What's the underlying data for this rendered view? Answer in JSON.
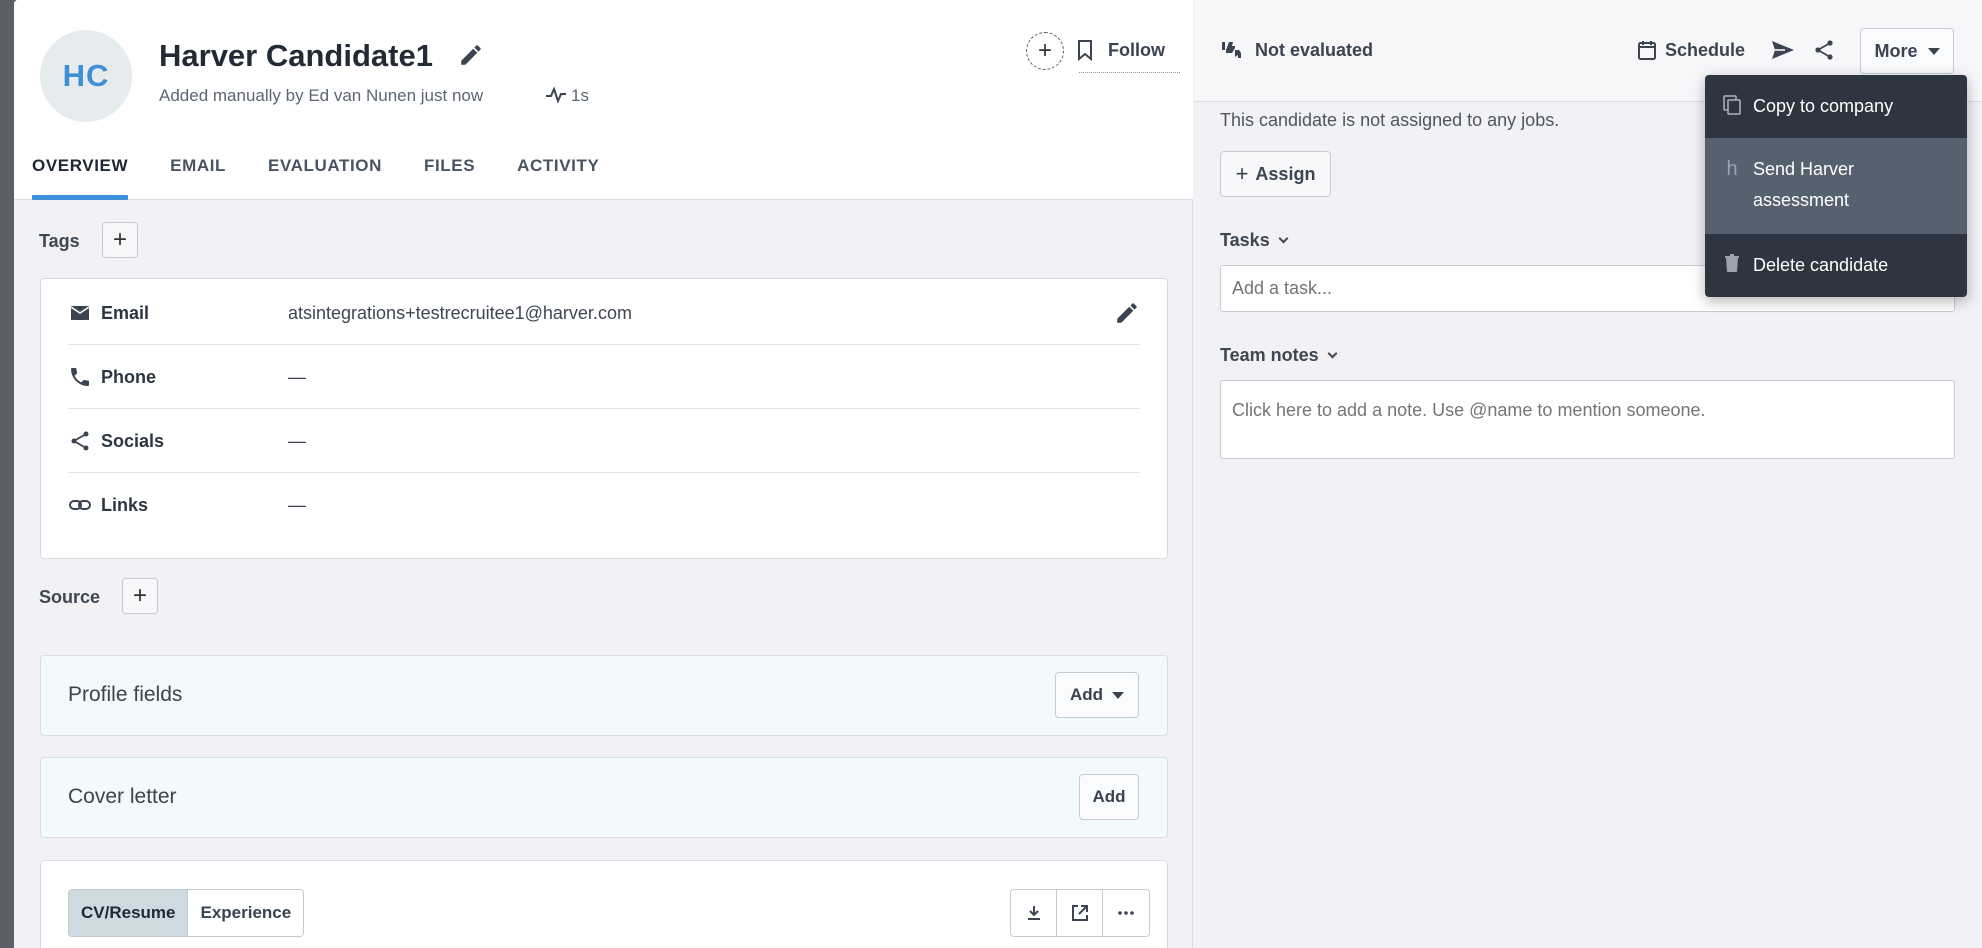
{
  "candidate": {
    "initials": "HC",
    "name": "Harver Candidate1",
    "added_text": "Added manually by Ed van Nunen just now",
    "age": "1s",
    "follow_label": "Follow"
  },
  "tabs": [
    {
      "label": "OVERVIEW",
      "active": true
    },
    {
      "label": "EMAIL",
      "active": false
    },
    {
      "label": "EVALUATION",
      "active": false
    },
    {
      "label": "FILES",
      "active": false
    },
    {
      "label": "ACTIVITY",
      "active": false
    }
  ],
  "tags_label": "Tags",
  "contact": {
    "rows": [
      {
        "label": "Email",
        "value": "atsintegrations+testrecruitee1@harver.com",
        "icon": "envelope-icon"
      },
      {
        "label": "Phone",
        "value": "—",
        "icon": "phone-icon"
      },
      {
        "label": "Socials",
        "value": "—",
        "icon": "share-icon"
      },
      {
        "label": "Links",
        "value": "—",
        "icon": "link-icon"
      }
    ]
  },
  "source_label": "Source",
  "profile_fields": {
    "title": "Profile fields",
    "button": "Add"
  },
  "cover_letter": {
    "title": "Cover letter",
    "button": "Add"
  },
  "cv": {
    "tabs": [
      "CV/Resume",
      "Experience"
    ]
  },
  "right": {
    "evaluation": "Not evaluated",
    "schedule": "Schedule",
    "more": "More",
    "not_assigned": "This candidate is not assigned to any jobs.",
    "assign": "Assign",
    "tasks_label": "Tasks",
    "task_placeholder": "Add a task...",
    "notes_label": "Team notes",
    "note_placeholder": "Click here to add a note. Use @name to mention someone."
  },
  "more_menu": {
    "items": [
      {
        "label": "Copy to company",
        "icon": "copy-icon"
      },
      {
        "label_line1": "Send Harver",
        "label_line2": "assessment",
        "icon": "harver-h-icon",
        "highlighted": true
      },
      {
        "label": "Delete candidate",
        "icon": "trash-icon"
      }
    ]
  },
  "colors": {
    "accent": "#3c8fd8",
    "menu_bg": "#2c3540",
    "menu_hover": "#566170"
  }
}
